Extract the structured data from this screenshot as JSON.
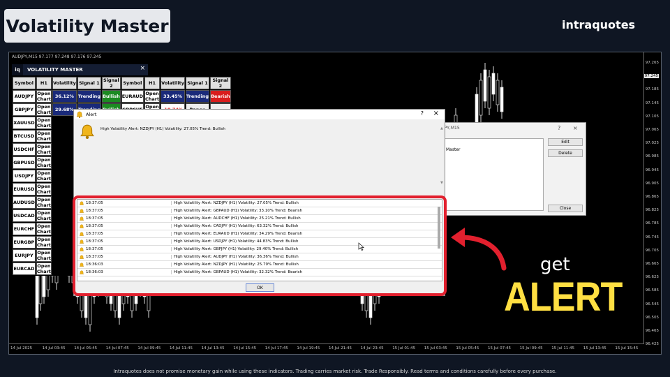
{
  "title": "Volatility Master",
  "brand": "intraquotes",
  "chart": {
    "symbol_header": "AUDJPY,M15  97.177 97.248 97.176 97.245",
    "price_labels": [
      "97.265",
      "97.245",
      "97.185",
      "97.145",
      "97.105",
      "97.065",
      "97.025",
      "96.985",
      "96.945",
      "96.905",
      "96.865",
      "96.825",
      "96.785",
      "96.745",
      "96.705",
      "96.665",
      "96.625",
      "96.585",
      "96.545",
      "96.505",
      "96.465",
      "96.425"
    ],
    "highlight_price": "97.245",
    "time_labels": [
      "14 Jul 2025",
      "14 Jul 03:45",
      "14 Jul 05:45",
      "14 Jul 07:45",
      "14 Jul 09:45",
      "14 Jul 11:45",
      "14 Jul 13:45",
      "14 Jul 15:45",
      "14 Jul 17:45",
      "14 Jul 19:45",
      "14 Jul 21:45",
      "14 Jul 23:45",
      "15 Jul 01:45",
      "15 Jul 03:45",
      "15 Jul 05:45",
      "15 Jul 07:45",
      "15 Jul 09:45",
      "15 Jul 11:45",
      "15 Jul 13:45",
      "15 Jul 15:45"
    ]
  },
  "panel": {
    "logo": "iq",
    "title": "VOLATILITY MASTER",
    "close": "×",
    "headers": [
      "Symbol",
      "H1",
      "Volatility",
      "Signal 1",
      "Signal 2",
      "Symbol",
      "H1",
      "Volatility",
      "Signal 1",
      "Signal 2"
    ],
    "rows": [
      [
        "AUDJPY",
        "Open Chart",
        "36.12%",
        "Trending",
        "Bullish",
        "EURAUD",
        "Open Chart",
        "33.45%",
        "Trending",
        "Bearish"
      ],
      [
        "GBPJPY",
        "Open Chart",
        "29.68%",
        "Trending",
        "Bullish",
        "GBPCHF",
        "Open Chart",
        "-18.74%",
        "Range",
        "-"
      ],
      [
        "XAUUSD",
        "Open Chart",
        "",
        "",
        "",
        "",
        "",
        "",
        "",
        ""
      ],
      [
        "BTCUSD",
        "Open Chart",
        "",
        "",
        "",
        "",
        "",
        "",
        "",
        ""
      ],
      [
        "USDCHF",
        "Open Chart",
        "",
        "",
        "",
        "",
        "",
        "",
        "",
        ""
      ],
      [
        "GBPUSD",
        "Open Chart",
        "",
        "",
        "",
        "",
        "",
        "",
        "",
        ""
      ],
      [
        "USDJPY",
        "Open Chart",
        "",
        "",
        "",
        "",
        "",
        "",
        "",
        ""
      ],
      [
        "EURUSD",
        "Open Chart",
        "",
        "",
        "",
        "",
        "",
        "",
        "",
        ""
      ],
      [
        "AUDUSD",
        "Open Chart",
        "",
        "",
        "",
        "",
        "",
        "",
        "",
        ""
      ],
      [
        "USDCAD",
        "Open Chart",
        "",
        "",
        "",
        "",
        "",
        "",
        "",
        ""
      ],
      [
        "EURCHF",
        "Open Chart",
        "",
        "",
        "",
        "",
        "",
        "",
        "",
        ""
      ],
      [
        "EURGBP",
        "Open Chart",
        "",
        "",
        "",
        "",
        "",
        "",
        "",
        ""
      ],
      [
        "EURJPY",
        "Open Chart",
        "",
        "",
        "",
        "",
        "",
        "",
        "",
        ""
      ],
      [
        "EURCAD",
        "Open Chart",
        "",
        "",
        "",
        "",
        "",
        "",
        "",
        ""
      ]
    ]
  },
  "bg_dialog": {
    "title": "JPY,M15",
    "help": "?",
    "close": "×",
    "list_item": "Master",
    "edit": "Edit",
    "delete": "Delete",
    "close_btn": "Close"
  },
  "alert": {
    "title": "Alert",
    "help": "?",
    "close": "×",
    "message": "High Volatility Alert: NZDJPY (H1) Volatility: 27.05% Trend: Bullish",
    "rows": [
      {
        "time": "18:37:05",
        "text": "High Volatility Alert: NZDJPY (H1) Volatility: 27.05% Trend: Bullish"
      },
      {
        "time": "18:37:05",
        "text": "High Volatility Alert: GBPAUD (H1) Volatility: 33.10% Trend: Bearish"
      },
      {
        "time": "18:37:05",
        "text": "High Volatility Alert: AUDCHF (H1) Volatility: 25.21% Trend: Bullish"
      },
      {
        "time": "18:37:05",
        "text": "High Volatility Alert: CADJPY (H1) Volatility: 63.32% Trend: Bullish"
      },
      {
        "time": "18:37:05",
        "text": "High Volatility Alert: EURAUD (H1) Volatility: 34.29% Trend: Bearish"
      },
      {
        "time": "18:37:05",
        "text": "High Volatility Alert: USDJPY (H1) Volatility: 44.83% Trend: Bullish"
      },
      {
        "time": "18:37:05",
        "text": "High Volatility Alert: GBPJPY (H1) Volatility: 29.40% Trend: Bullish"
      },
      {
        "time": "18:37:05",
        "text": "High Volatility Alert: AUDJPY (H1) Volatility: 36.36% Trend: Bullish"
      },
      {
        "time": "18:36:03",
        "text": "High Volatility Alert: NZDJPY (H1) Volatility: 25.79% Trend: Bullish"
      },
      {
        "time": "18:36:03",
        "text": "High Volatility Alert: GBPAUD (H1) Volatility: 32.32% Trend: Bearish"
      }
    ],
    "ok": "OK"
  },
  "promo": {
    "get": "get",
    "alert": "ALERT"
  },
  "disclaimer": "Intraquotes does not promise monetary gain while using these indicators. Trading carries market risk. Trade Responsibly. Read terms and conditions carefully before every purchase.",
  "colors": {
    "accent_red": "#e2202e",
    "alert_yellow": "#ffdf42",
    "bull_green": "#1c8a22",
    "bear_red": "#d81d1d",
    "navy": "#1a2a7a"
  }
}
